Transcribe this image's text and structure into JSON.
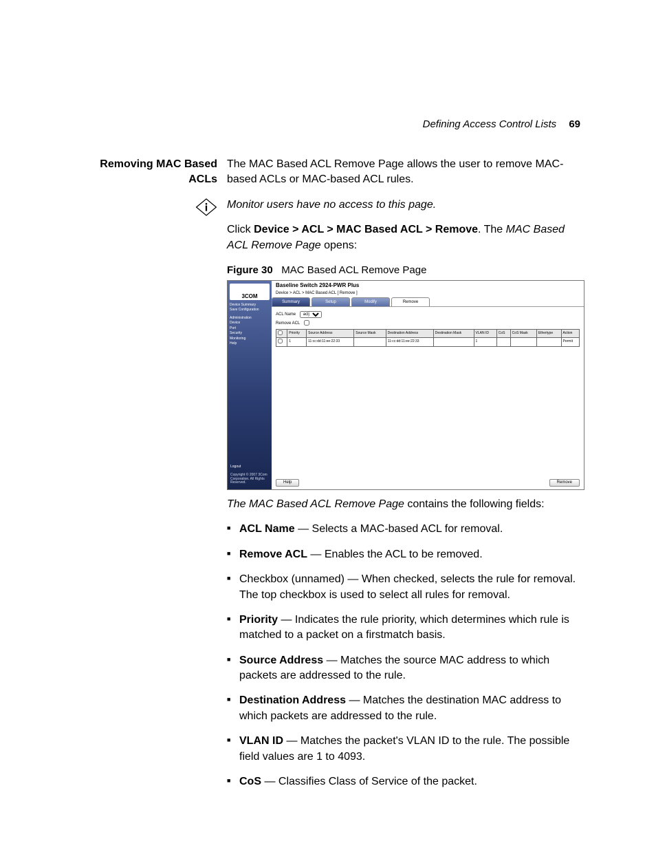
{
  "header": {
    "section": "Defining Access Control Lists",
    "page": "69"
  },
  "margin_heading": {
    "l1": "Removing MAC Based",
    "l2": "ACLs"
  },
  "intro": "The MAC Based ACL Remove Page allows the user to remove MAC-based ACLs or MAC-based ACL rules.",
  "note": "Monitor users have no access to this page.",
  "click": {
    "pre": "Click ",
    "path": "Device > ACL > MAC Based ACL > Remove",
    "post1": ". The ",
    "ital": "MAC Based ACL Remove Page",
    "post2": " opens:"
  },
  "figure": {
    "label": "Figure 30",
    "caption": "MAC Based ACL Remove Page"
  },
  "screenshot": {
    "logo": "3COM",
    "title": "Baseline Switch 2924-PWR Plus",
    "crumb": "Device > ACL > MAC Based ACL [ Remove ]",
    "side": {
      "top": [
        "Device Summary",
        "Save Configuration"
      ],
      "group": "Administration",
      "items": [
        "Device",
        "Port",
        "Security",
        "Monitoring",
        "Help"
      ],
      "logout": "Logout",
      "copyright": "Copyright © 2007 3Com Corporation. All Rights Reserved."
    },
    "tabs": [
      "Summary",
      "Setup",
      "Modify",
      "Remove"
    ],
    "fields": {
      "acl_name_label": "ACL Name",
      "acl_name_value": "aclj",
      "remove_acl_label": "Remove ACL"
    },
    "table": {
      "headers": [
        "",
        "Priority",
        "Source Address",
        "Source Mask",
        "Destination Address",
        "Destination Mask",
        "VLAN ID",
        "CoS",
        "CoS Mask",
        "Ethertype",
        "Action"
      ],
      "row": [
        "",
        "1",
        "11:cc:dd:11:ee:22:33",
        "",
        "11:cc:dd:11:ee:22:33",
        "",
        "1",
        "",
        "",
        "",
        "Permit"
      ]
    },
    "buttons": {
      "help": "Help",
      "remove": "Remove"
    }
  },
  "fields_intro": {
    "ital": "The MAC Based ACL Remove Page",
    "rest": " contains the following fields:"
  },
  "bullets": [
    {
      "term": "ACL Name",
      "dash": " — ",
      "desc": "Selects a MAC-based ACL for removal."
    },
    {
      "term": "Remove ACL",
      "dash": " — ",
      "desc": "Enables the ACL to be removed."
    },
    {
      "term": "",
      "dash": "",
      "desc": "Checkbox (unnamed) — When checked, selects the rule for removal. The top checkbox is used to select all rules for removal."
    },
    {
      "term": "Priority",
      "dash": " — ",
      "desc": "Indicates the rule priority, which determines which rule is matched to a packet on a firstmatch basis."
    },
    {
      "term": "Source Address",
      "dash": " — ",
      "desc": "Matches the source MAC address to which packets are addressed to the rule."
    },
    {
      "term": "Destination Address",
      "dash": " — ",
      "desc": "Matches the destination MAC address to which packets are addressed to the rule."
    },
    {
      "term": "VLAN ID",
      "dash": " — ",
      "desc": "Matches the packet's VLAN ID to the rule. The possible field values are 1 to 4093."
    },
    {
      "term": "CoS",
      "dash": " — ",
      "desc": "Classifies Class of Service of the packet."
    }
  ]
}
